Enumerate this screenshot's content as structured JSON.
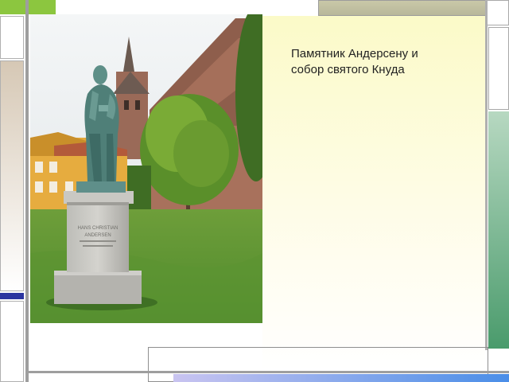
{
  "slide": {
    "caption_line1": "Памятник Андерсену и",
    "caption_line2": "собор святого Кнуда"
  },
  "photo": {
    "pedestal_inscription": [
      "HANS CHRISTIAN",
      "ANDERSEN",
      "",
      ""
    ]
  },
  "colors": {
    "accent_green": "#8cc63f",
    "accent_blue": "#2b35a0",
    "panel_yellow": "#fbfac8"
  }
}
